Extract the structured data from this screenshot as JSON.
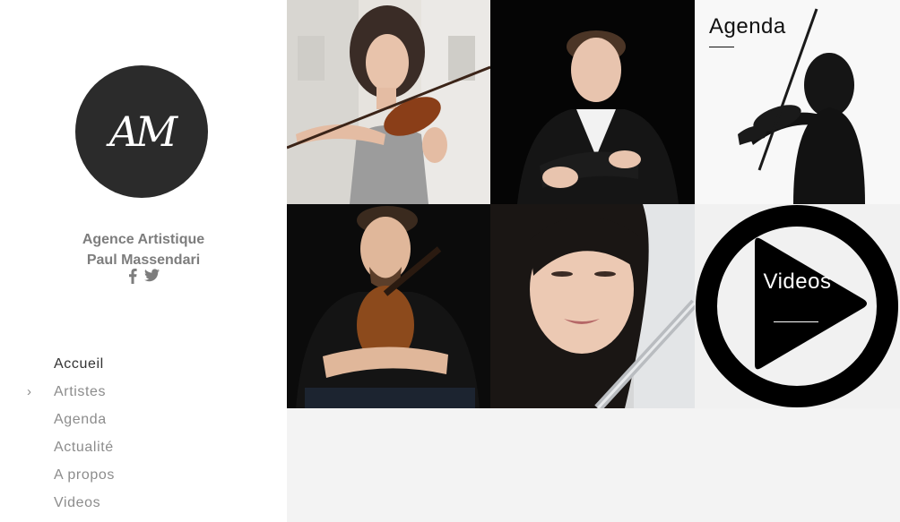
{
  "brand": {
    "logo_text": "AM",
    "agency_line1": "Agence Artistique",
    "agency_line2": "Paul Massendari"
  },
  "social": {
    "icons": [
      "facebook-icon",
      "twitter-icon"
    ]
  },
  "nav": {
    "items": [
      {
        "label": "Accueil",
        "active": true
      },
      {
        "label": "Artistes"
      },
      {
        "label": "Agenda"
      },
      {
        "label": "Actualité"
      },
      {
        "label": "A propos"
      },
      {
        "label": "Videos"
      }
    ],
    "arrow": "›"
  },
  "tiles": {
    "agenda_label": "Agenda",
    "videos_label": "Videos"
  },
  "colors": {
    "sidebar_bg": "#ffffff",
    "page_bg": "#f3f3f3",
    "logo_bg": "#2b2b2b",
    "text_muted": "#8c8c8c",
    "text_active": "#333333"
  }
}
